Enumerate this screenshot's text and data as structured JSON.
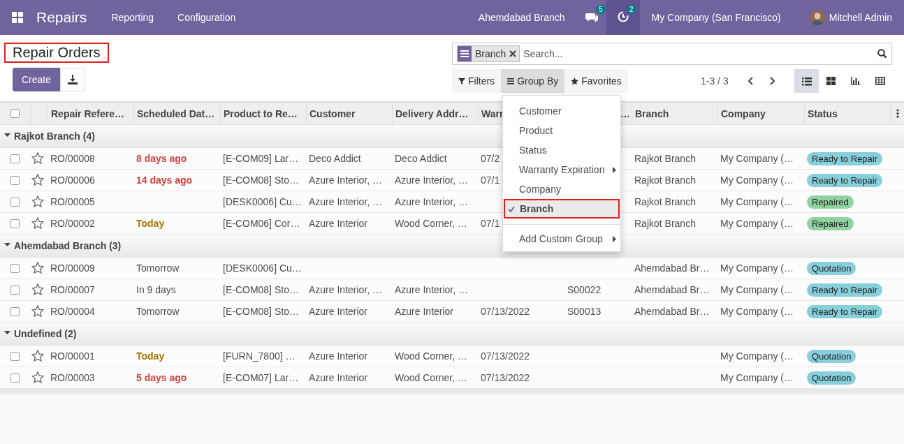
{
  "navbar": {
    "app_name": "Repairs",
    "menus": [
      "Reporting",
      "Configuration"
    ],
    "branch": "Ahemdabad Branch",
    "messages_badge": "5",
    "activities_badge": "2",
    "company": "My Company (San Francisco)",
    "user": "Mitchell Admin"
  },
  "breadcrumb": "Repair Orders",
  "create_button": "Create",
  "search": {
    "facets": [
      "Branch"
    ],
    "placeholder": "Search..."
  },
  "search_options": [
    {
      "label": "Filters",
      "kind": "filter",
      "selected": false
    },
    {
      "label": "Group By",
      "kind": "group",
      "selected": true
    },
    {
      "label": "Favorites",
      "kind": "star",
      "selected": false
    }
  ],
  "pager": "1-3 / 3",
  "views": [
    {
      "kind": "list",
      "selected": true
    },
    {
      "kind": "kanban",
      "selected": false
    },
    {
      "kind": "graph",
      "selected": false
    },
    {
      "kind": "pivot",
      "selected": false
    }
  ],
  "table": {
    "all_selected": false,
    "columns": [
      "Repair Refere…",
      "Scheduled Dat…",
      "Product to Re…",
      "Customer",
      "Delivery Addr…",
      "Warr",
      "…",
      "Branch",
      "Company",
      "Status"
    ],
    "groups": [
      {
        "label": "Rajkot Branch (4)",
        "expanded": true,
        "rows": [
          {
            "selected": false,
            "cells": [
              "RO/00008",
              {
                "text": "8 days ago",
                "kind": "late"
              },
              "[E-COM09] Lar…",
              "Deco Addict",
              "Deco Addict",
              "07/2",
              "",
              "Rajkot Branch",
              "My Company (…"
            ],
            "status": {
              "text": "Ready to Repair",
              "kind": "ready"
            }
          },
          {
            "selected": false,
            "cells": [
              "RO/00006",
              {
                "text": "14 days ago",
                "kind": "late"
              },
              "[E-COM08] Sto…",
              "Azure Interior, …",
              "Azure Interior, …",
              "07/1",
              "",
              "Rajkot Branch",
              "My Company (…"
            ],
            "status": {
              "text": "Ready to Repair",
              "kind": "ready"
            }
          },
          {
            "selected": false,
            "cells": [
              "RO/00005",
              "",
              "[DESK0006] Cu…",
              "Azure Interior, …",
              "Azure Interior, …",
              "",
              "",
              "Rajkot Branch",
              "My Company (…"
            ],
            "status": {
              "text": "Repaired",
              "kind": "repaired"
            }
          },
          {
            "selected": false,
            "cells": [
              "RO/00002",
              {
                "text": "Today",
                "kind": "today"
              },
              "[E-COM06] Cor…",
              "Azure Interior",
              "Wood Corner, …",
              "07/1",
              "",
              "Rajkot Branch",
              "My Company (…"
            ],
            "status": {
              "text": "Repaired",
              "kind": "repaired"
            }
          }
        ]
      },
      {
        "label": "Ahemdabad Branch (3)",
        "expanded": true,
        "rows": [
          {
            "selected": false,
            "cells": [
              "RO/00009",
              "Tomorrow",
              "[DESK0006] Cu…",
              "",
              "",
              "",
              "",
              "Ahemdabad Br…",
              "My Company (…"
            ],
            "status": {
              "text": "Quotation",
              "kind": "quotation"
            }
          },
          {
            "selected": false,
            "cells": [
              "RO/00007",
              "In 9 days",
              "[E-COM08] Sto…",
              "Azure Interior, …",
              "Azure Interior, …",
              "",
              "S00022",
              "Ahemdabad Br…",
              "My Company (…"
            ],
            "status": {
              "text": "Ready to Repair",
              "kind": "ready"
            }
          },
          {
            "selected": false,
            "cells": [
              "RO/00004",
              "Tomorrow",
              "[E-COM08] Sto…",
              "Azure Interior",
              "Azure Interior",
              "07/13/2022",
              "S00013",
              "Ahemdabad Br…",
              "My Company (…"
            ],
            "status": {
              "text": "Ready to Repair",
              "kind": "ready"
            }
          }
        ]
      },
      {
        "label": "Undefined (2)",
        "expanded": true,
        "rows": [
          {
            "selected": false,
            "cells": [
              "RO/00001",
              {
                "text": "Today",
                "kind": "today"
              },
              "[FURN_7800] …",
              "Azure Interior",
              "Wood Corner, …",
              "07/13/2022",
              "",
              "",
              "My Company (…"
            ],
            "status": {
              "text": "Quotation",
              "kind": "quotation"
            }
          },
          {
            "selected": false,
            "cells": [
              "RO/00003",
              {
                "text": "5 days ago",
                "kind": "late"
              },
              "[E-COM07] Lar…",
              "Azure Interior",
              "Wood Corner, …",
              "07/13/2022",
              "",
              "",
              "My Company (…"
            ],
            "status": {
              "text": "Quotation",
              "kind": "quotation"
            }
          }
        ]
      }
    ]
  },
  "group_by_menu": [
    {
      "label": "Customer",
      "kind": "option",
      "selected": false,
      "submenu": false
    },
    {
      "label": "Product",
      "kind": "option",
      "selected": false,
      "submenu": false
    },
    {
      "label": "Status",
      "kind": "option",
      "selected": false,
      "submenu": false
    },
    {
      "label": "Warranty Expiration",
      "kind": "option",
      "selected": false,
      "submenu": true
    },
    {
      "label": "Company",
      "kind": "option",
      "selected": false,
      "submenu": false
    },
    {
      "label": "Branch",
      "kind": "option",
      "selected": true,
      "submenu": false
    },
    {
      "label": "Add Custom Group",
      "kind": "custom",
      "selected": false,
      "submenu": true
    }
  ]
}
